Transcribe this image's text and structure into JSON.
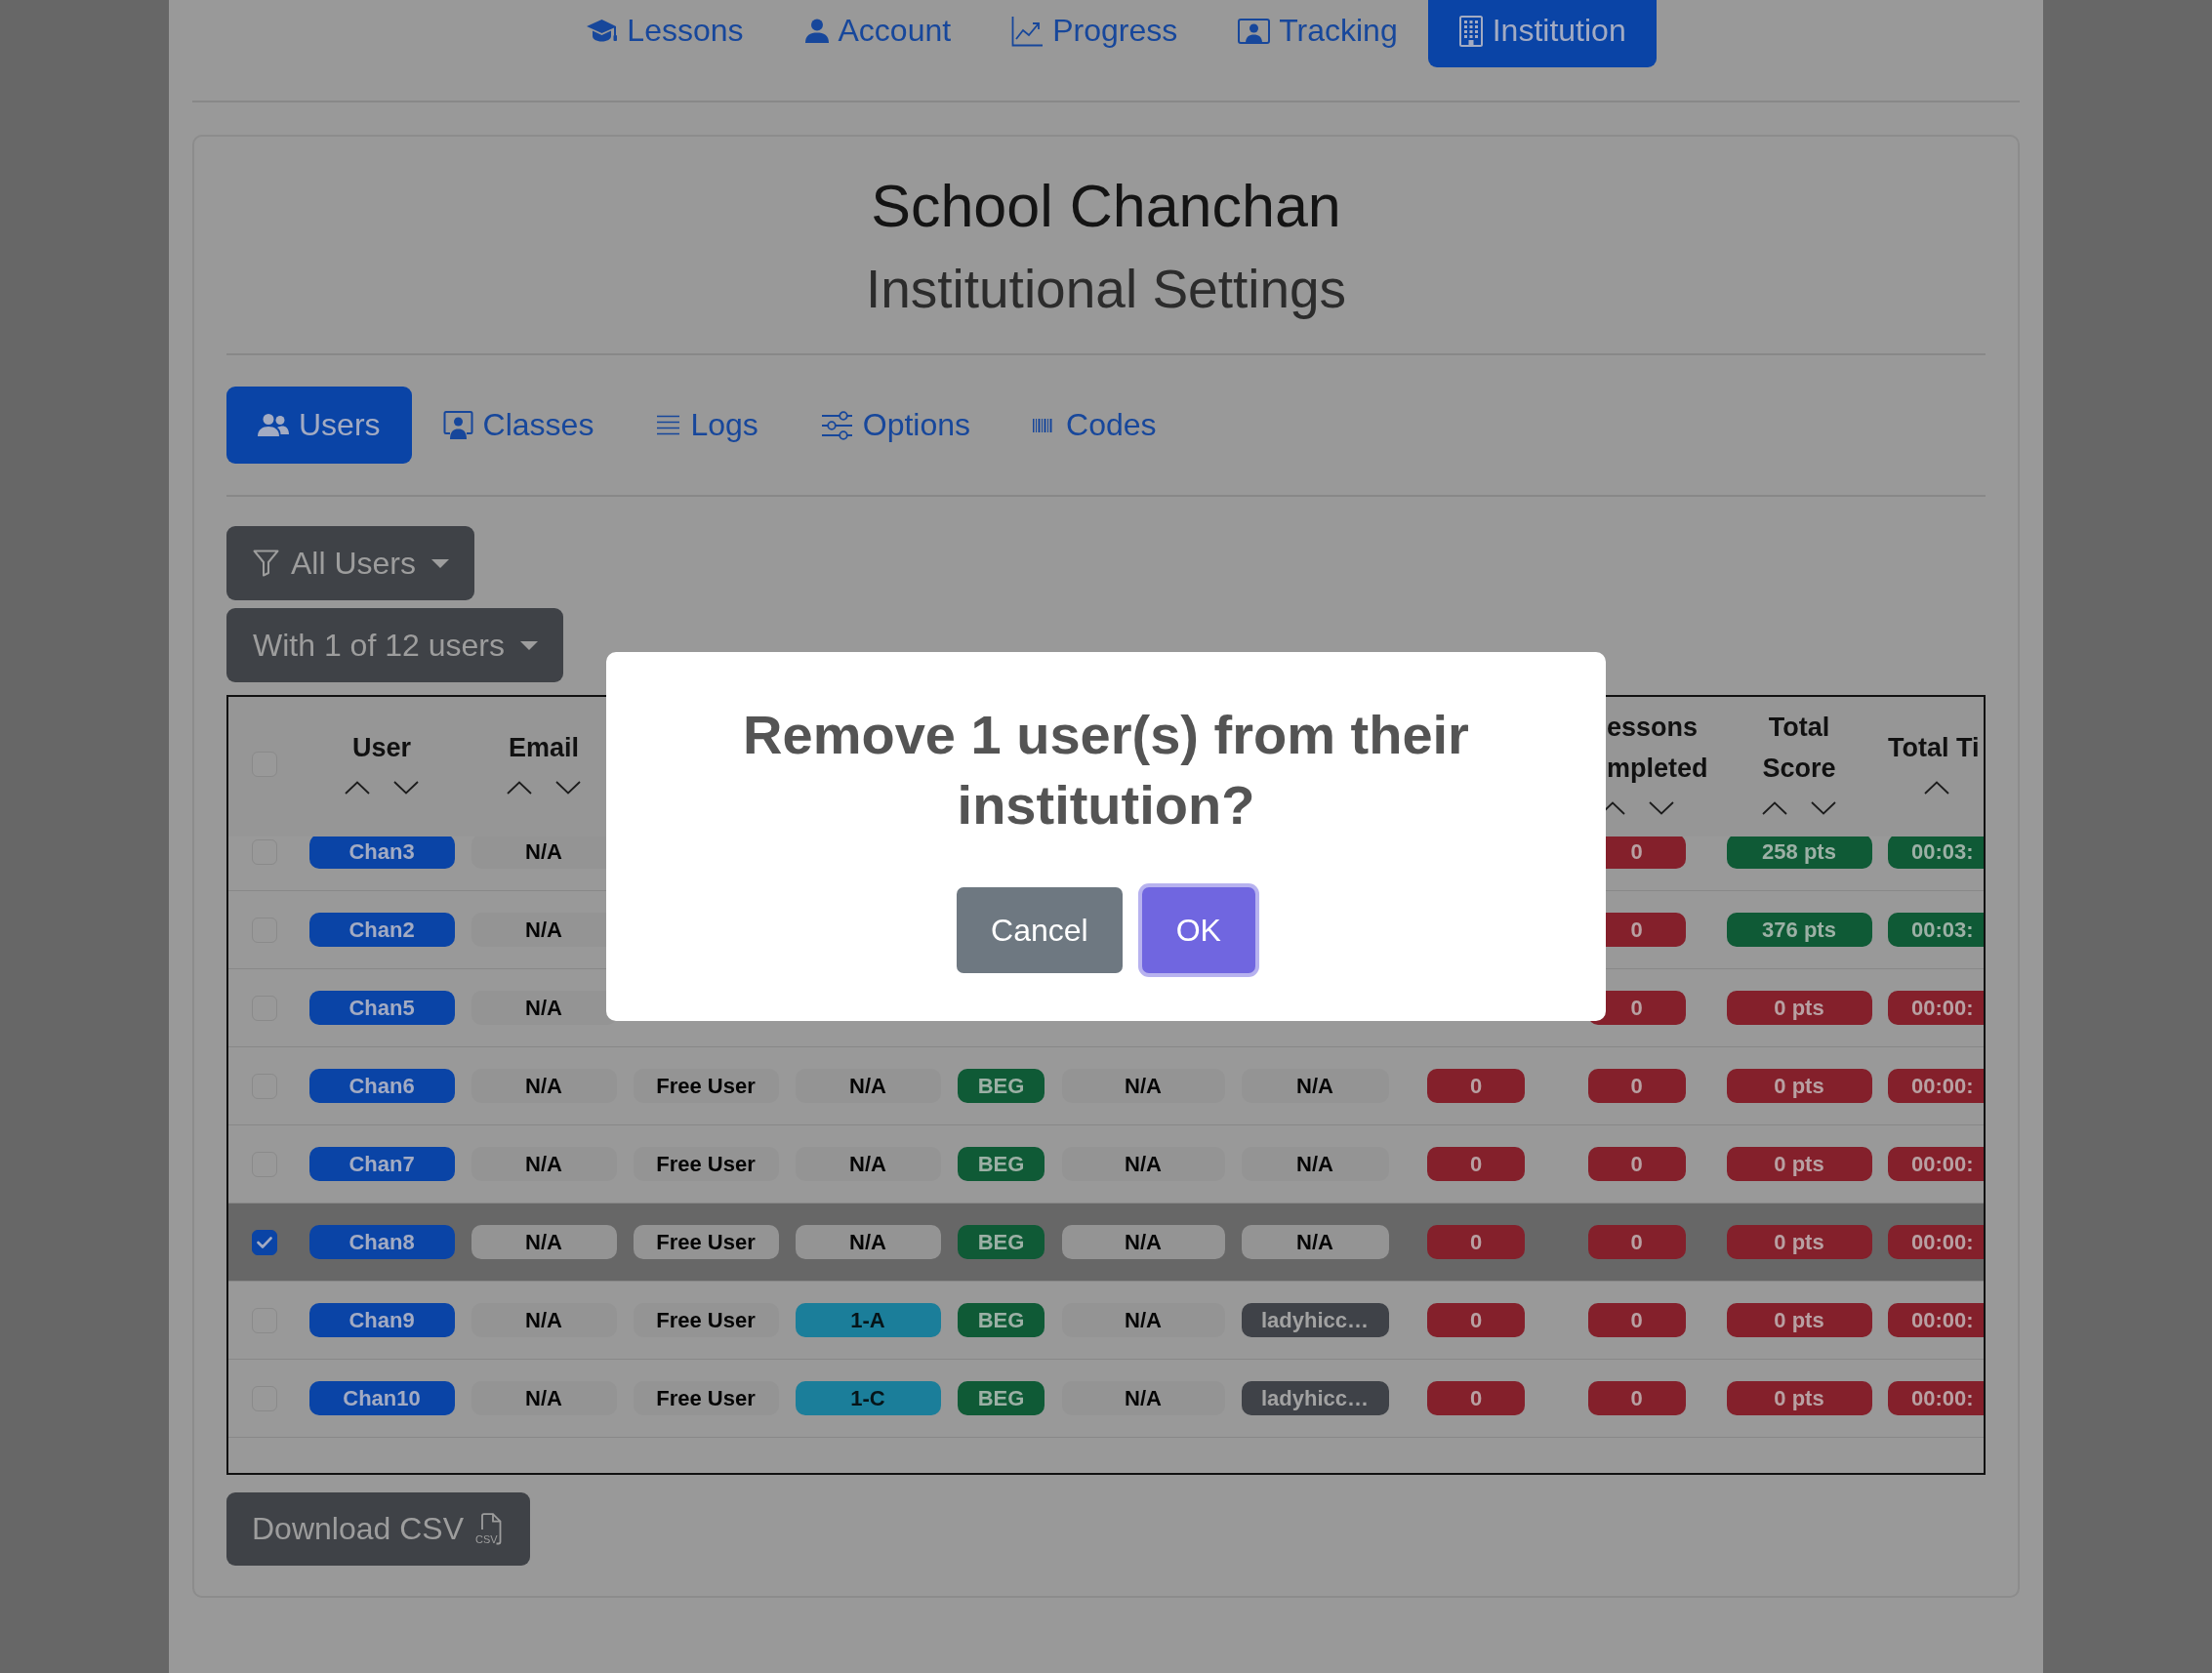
{
  "nav": {
    "items": [
      {
        "label": "Lessons",
        "selected": false
      },
      {
        "label": "Account",
        "selected": false
      },
      {
        "label": "Progress",
        "selected": false
      },
      {
        "label": "Tracking",
        "selected": false
      },
      {
        "label": "Institution",
        "selected": true
      }
    ]
  },
  "header": {
    "title": "School Chanchan",
    "subtitle": "Institutional Settings"
  },
  "tabs": [
    {
      "label": "Users",
      "selected": true
    },
    {
      "label": "Classes",
      "selected": false
    },
    {
      "label": "Logs",
      "selected": false
    },
    {
      "label": "Options",
      "selected": false
    },
    {
      "label": "Codes",
      "selected": false
    }
  ],
  "filters": [
    {
      "label": "All Users"
    },
    {
      "label": "With 1 of 12 users"
    }
  ],
  "table": {
    "select_all": {
      "checked": false
    },
    "columns": [
      "User",
      "Email",
      null,
      null,
      null,
      null,
      null,
      null,
      "essons mpleted",
      "Total Score",
      "Total Ti"
    ],
    "rows": [
      {
        "selected": false,
        "cells": [
          {
            "text": "Chan3",
            "kind": "primary"
          },
          {
            "text": "N/A",
            "kind": "light"
          },
          null,
          null,
          null,
          null,
          null,
          null,
          {
            "text": "0",
            "kind": "danger"
          },
          {
            "text": "258 pts",
            "kind": "success"
          },
          {
            "text": "00:03:",
            "kind": "success"
          }
        ]
      },
      {
        "selected": false,
        "cells": [
          {
            "text": "Chan2",
            "kind": "primary"
          },
          {
            "text": "N/A",
            "kind": "light"
          },
          null,
          null,
          null,
          null,
          null,
          null,
          {
            "text": "0",
            "kind": "danger"
          },
          {
            "text": "376 pts",
            "kind": "success"
          },
          {
            "text": "00:03:",
            "kind": "success"
          }
        ]
      },
      {
        "selected": false,
        "cells": [
          {
            "text": "Chan5",
            "kind": "primary"
          },
          {
            "text": "N/A",
            "kind": "light"
          },
          null,
          null,
          null,
          null,
          null,
          null,
          {
            "text": "0",
            "kind": "danger"
          },
          {
            "text": "0 pts",
            "kind": "danger"
          },
          {
            "text": "00:00:",
            "kind": "danger"
          }
        ]
      },
      {
        "selected": false,
        "cells": [
          {
            "text": "Chan6",
            "kind": "primary"
          },
          {
            "text": "N/A",
            "kind": "light"
          },
          {
            "text": "Free User",
            "kind": "light"
          },
          {
            "text": "N/A",
            "kind": "light"
          },
          {
            "text": "BEG",
            "kind": "success"
          },
          {
            "text": "N/A",
            "kind": "light"
          },
          {
            "text": "N/A",
            "kind": "light"
          },
          {
            "text": "0",
            "kind": "danger"
          },
          {
            "text": "0",
            "kind": "danger"
          },
          {
            "text": "0 pts",
            "kind": "danger"
          },
          {
            "text": "00:00:",
            "kind": "danger"
          }
        ]
      },
      {
        "selected": false,
        "cells": [
          {
            "text": "Chan7",
            "kind": "primary"
          },
          {
            "text": "N/A",
            "kind": "light"
          },
          {
            "text": "Free User",
            "kind": "light"
          },
          {
            "text": "N/A",
            "kind": "light"
          },
          {
            "text": "BEG",
            "kind": "success"
          },
          {
            "text": "N/A",
            "kind": "light"
          },
          {
            "text": "N/A",
            "kind": "light"
          },
          {
            "text": "0",
            "kind": "danger"
          },
          {
            "text": "0",
            "kind": "danger"
          },
          {
            "text": "0 pts",
            "kind": "danger"
          },
          {
            "text": "00:00:",
            "kind": "danger"
          }
        ]
      },
      {
        "selected": true,
        "cells": [
          {
            "text": "Chan8",
            "kind": "primary"
          },
          {
            "text": "N/A",
            "kind": "light"
          },
          {
            "text": "Free User",
            "kind": "light"
          },
          {
            "text": "N/A",
            "kind": "light"
          },
          {
            "text": "BEG",
            "kind": "success"
          },
          {
            "text": "N/A",
            "kind": "light"
          },
          {
            "text": "N/A",
            "kind": "light"
          },
          {
            "text": "0",
            "kind": "danger"
          },
          {
            "text": "0",
            "kind": "danger"
          },
          {
            "text": "0 pts",
            "kind": "danger"
          },
          {
            "text": "00:00:",
            "kind": "danger"
          }
        ]
      },
      {
        "selected": false,
        "cells": [
          {
            "text": "Chan9",
            "kind": "primary"
          },
          {
            "text": "N/A",
            "kind": "light"
          },
          {
            "text": "Free User",
            "kind": "light"
          },
          {
            "text": "1-A",
            "kind": "info"
          },
          {
            "text": "BEG",
            "kind": "success"
          },
          {
            "text": "N/A",
            "kind": "light"
          },
          {
            "text": "ladyhicc…",
            "kind": "dark"
          },
          {
            "text": "0",
            "kind": "danger"
          },
          {
            "text": "0",
            "kind": "danger"
          },
          {
            "text": "0 pts",
            "kind": "danger"
          },
          {
            "text": "00:00:",
            "kind": "danger"
          }
        ]
      },
      {
        "selected": false,
        "cells": [
          {
            "text": "Chan10",
            "kind": "primary"
          },
          {
            "text": "N/A",
            "kind": "light"
          },
          {
            "text": "Free User",
            "kind": "light"
          },
          {
            "text": "1-C",
            "kind": "info"
          },
          {
            "text": "BEG",
            "kind": "success"
          },
          {
            "text": "N/A",
            "kind": "light"
          },
          {
            "text": "ladyhicc…",
            "kind": "dark"
          },
          {
            "text": "0",
            "kind": "danger"
          },
          {
            "text": "0",
            "kind": "danger"
          },
          {
            "text": "0 pts",
            "kind": "danger"
          },
          {
            "text": "00:00:",
            "kind": "danger"
          }
        ]
      }
    ]
  },
  "download_button": {
    "label": "Download CSV",
    "file_type": "CSV"
  },
  "dialog": {
    "title": "Remove 1 user(s) from their institution?",
    "buttons": [
      {
        "label": "Cancel",
        "kind": "cancel",
        "focused": false
      },
      {
        "label": "OK",
        "kind": "confirm",
        "focused": true
      }
    ]
  }
}
